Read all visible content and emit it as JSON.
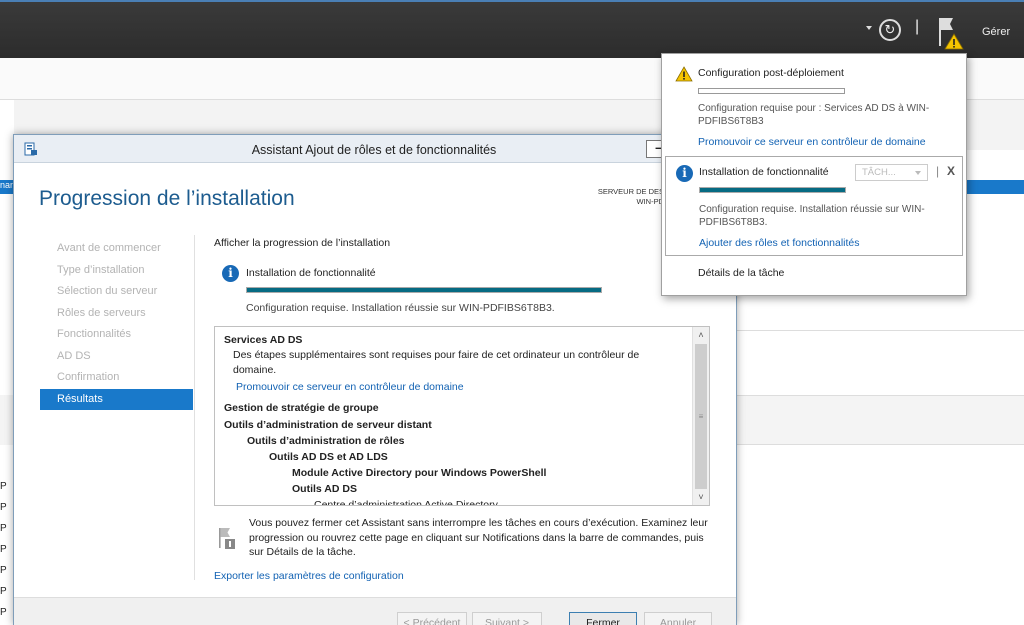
{
  "topbar": {
    "refresh_glyph": "↻",
    "separator": "|",
    "manage_label": "Gérer"
  },
  "sm_background": {
    "left_blue_text": "nan",
    "row_letters": [
      "P",
      "P",
      "P",
      "P",
      "P",
      "P",
      "P",
      "P"
    ]
  },
  "wizard": {
    "title": "Assistant Ajout de rôles et de fonctionnalités",
    "minimize_glyph": "–",
    "heading": "Progression de l’installation",
    "destination": {
      "line1": "SERVEUR DE DES",
      "line2": "WIN-PD"
    },
    "nav": [
      {
        "label": "Avant de commencer",
        "active": false
      },
      {
        "label": "Type d’installation",
        "active": false
      },
      {
        "label": "Sélection du serveur",
        "active": false
      },
      {
        "label": "Rôles de serveurs",
        "active": false
      },
      {
        "label": "Fonctionnalités",
        "active": false
      },
      {
        "label": "AD DS",
        "active": false
      },
      {
        "label": "Confirmation",
        "active": false
      },
      {
        "label": "Résultats",
        "active": true
      }
    ],
    "progress_label": "Afficher la progression de l’installation",
    "feature_title": "Installation de fonctionnalité",
    "progress_fraction": 1.0,
    "feature_status": "Configuration requise. Installation réussie sur WIN-PDFIBS6T8B3.",
    "results": {
      "ad_ds_title": "Services AD DS",
      "ad_ds_desc": "Des étapes supplémentaires sont requises pour faire de cet ordinateur un contrôleur de domaine.",
      "promote_link": "Promouvoir ce serveur en contrôleur de domaine",
      "gpo": "Gestion de stratégie de groupe",
      "rsat": "Outils d’administration de serveur distant",
      "role_tools": "Outils d’administration de rôles",
      "adds_adlds_tools": "Outils AD DS et AD LDS",
      "ps_module": "Module Active Directory pour Windows PowerShell",
      "adds_tools": "Outils AD DS",
      "ad_admin_center": "Centre d’administration Active Directory"
    },
    "scroll_up": "˄",
    "scroll_grip": "≡",
    "scroll_down": "˅",
    "close_note": "Vous pouvez fermer cet Assistant sans interrompre les tâches en cours d’exécution. Examinez leur progression ou rouvrez cette page en cliquant sur Notifications dans la barre de commandes, puis sur Détails de la tâche.",
    "export_link": "Exporter les paramètres de configuration",
    "buttons": {
      "prev": "< Précédent",
      "next": "Suivant >",
      "close": "Fermer",
      "cancel": "Annuler"
    }
  },
  "flyout": {
    "n1": {
      "title": "Configuration post-déploiement",
      "progress_fraction": 0.0,
      "desc": "Configuration requise pour : Services AD DS à WIN-PDFIBS6T8B3",
      "link": "Promouvoir ce serveur en contrôleur de domaine"
    },
    "n2": {
      "title": "Installation de fonctionnalité",
      "tasks_label": "TÂCH...",
      "separator": "|",
      "close_glyph": "X",
      "progress_fraction": 1.0,
      "desc": "Configuration requise. Installation réussie sur WIN-PDFIBS6T8B3.",
      "link": "Ajouter des rôles et fonctionnalités"
    },
    "task_details": "Détails de la tâche"
  },
  "colors": {
    "accent_blue": "#1979ca",
    "progress_teal": "#066b83",
    "link_blue": "#1262b3",
    "heading_blue": "#1d5c8f",
    "warning_yellow": "#f5c400"
  },
  "icons": {
    "refresh": "refresh-icon",
    "notifications": "flag-icon",
    "warning": "warning-icon",
    "info": "info-icon",
    "app": "server-manager-icon"
  }
}
